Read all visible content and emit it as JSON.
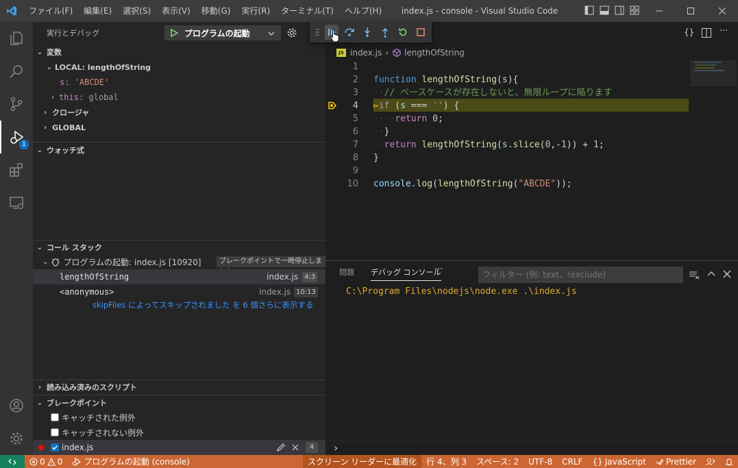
{
  "window": {
    "title": "index.js - console - Visual Studio Code",
    "menu": [
      "ファイル(F)",
      "編集(E)",
      "選択(S)",
      "表示(V)",
      "移動(G)",
      "実行(R)",
      "ターミナル(T)",
      "ヘルプ(H)"
    ]
  },
  "activity": {
    "debug_badge": "1"
  },
  "sidebar": {
    "title": "実行とデバッグ",
    "launch_config": "プログラムの起動",
    "variables": {
      "header": "変数",
      "local_scope": "LOCAL: lengthOfString",
      "s_name": "s:",
      "s_value": "'ABCDE'",
      "this_name": "this:",
      "this_value": "global",
      "closure": "クロージャ",
      "global": "GLOBAL"
    },
    "watch": {
      "header": "ウォッチ式"
    },
    "callstack": {
      "header": "コール スタック",
      "session": "プログラムの起動: index.js [10920]",
      "paused_reason": "ブレークポイントで一時停止しました",
      "frames": [
        {
          "name": "lengthOfString",
          "file": "index.js",
          "pos": "4:3"
        },
        {
          "name": "<anonymous>",
          "file": "index.js",
          "pos": "10:13"
        }
      ],
      "skipped": "skipFiles によってスキップされました を 6 個さらに表示する"
    },
    "loaded_scripts": {
      "header": "読み込み済みのスクリプト"
    },
    "breakpoints": {
      "header": "ブレークポイント",
      "caught": "キャッチされた例外",
      "uncaught": "キャッチされない例外",
      "file": "index.js",
      "count": "4"
    }
  },
  "editor": {
    "breadcrumb_file": "index.js",
    "breadcrumb_symbol": "lengthOfString",
    "line_numbers": [
      "1",
      "2",
      "3",
      "4",
      "5",
      "6",
      "7",
      "8",
      "9",
      "10"
    ],
    "code": {
      "l2_kw": "function",
      "l2_fn": "lengthOfString",
      "l2_p1": "(",
      "l2_pm": "s",
      "l2_p2": "){",
      "l3_cm": "// ベースケースが存在しないと、無限ループに陥ります",
      "l4_kw": "if",
      "l4_a": " (",
      "l4_pm": "s",
      "l4_op": " === ",
      "l4_str": "''",
      "l4_b": ") {",
      "l5_kw": "return",
      "l5_num": "0",
      "l5_end": ";",
      "l6": "}",
      "l7_kw": "return",
      "l7_fn": "lengthOfString",
      "l7_a": "(",
      "l7_pm": "s",
      "l7_dot": ".",
      "l7_fn2": "slice",
      "l7_b": "(",
      "l7_n1": "0",
      "l7_c": ",-",
      "l7_n2": "1",
      "l7_d": ")) + ",
      "l7_n3": "1",
      "l7_e": ";",
      "l8": "}",
      "l10_pm": "console",
      "l10_dot": ".",
      "l10_fn": "log",
      "l10_a": "(",
      "l10_fn2": "lengthOfString",
      "l10_b": "(",
      "l10_str": "\"ABCDE\"",
      "l10_c": "));"
    }
  },
  "panel": {
    "tab_problems": "問題",
    "tab_debug_console": "デバッグ コンソール",
    "more": "···",
    "filter_placeholder": "フィルター (例: text、!exclude)",
    "output_line": "C:\\Program Files\\nodejs\\node.exe .\\index.js",
    "prompt": "›"
  },
  "statusbar": {
    "errors": "0",
    "warnings": "0",
    "debug_session": "プログラムの起動 (console)",
    "screen_reader": "スクリーン リーダーに最適化",
    "position": "行 4、列 3",
    "spaces": "スペース: 2",
    "encoding": "UTF-8",
    "eol": "CRLF",
    "language": "JavaScript",
    "prettier": "Prettier"
  },
  "colors": {
    "statusbar": "#cc6633",
    "remote": "#16825d",
    "accent": "#0e70c0",
    "current_line": "#4b4b18"
  }
}
